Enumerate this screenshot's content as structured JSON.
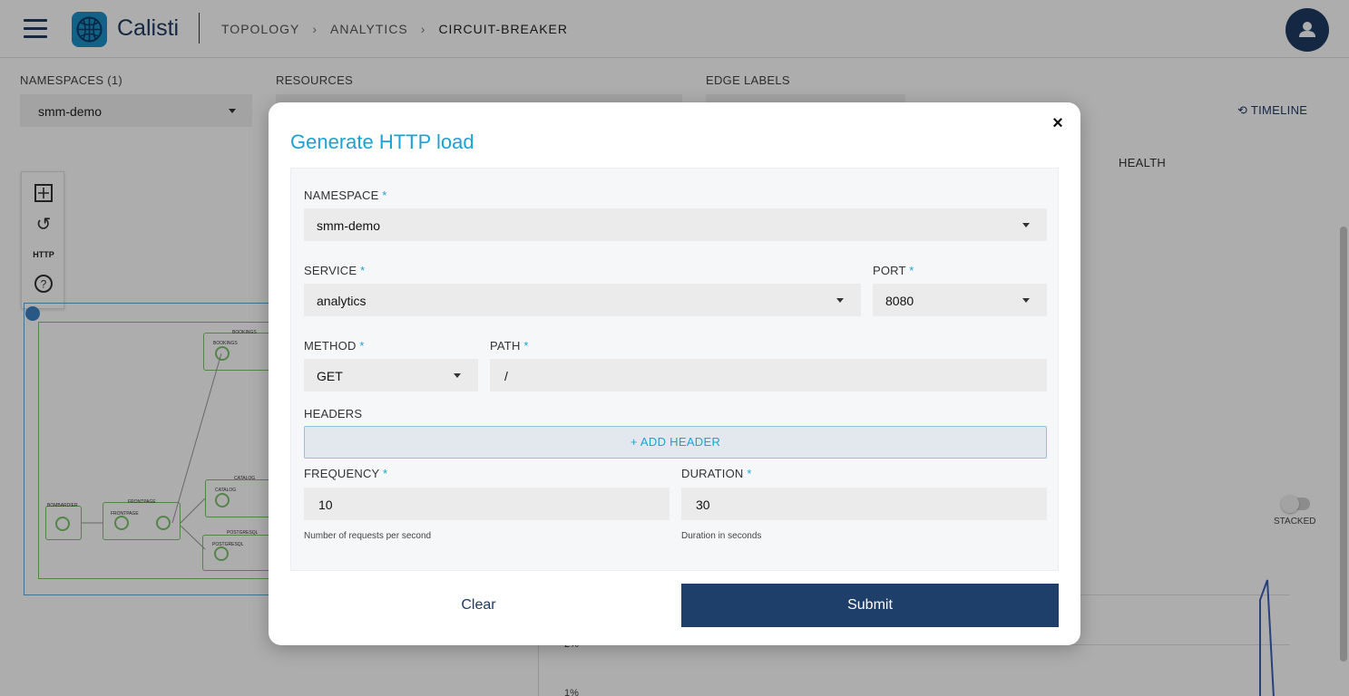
{
  "app": {
    "brand": "Calisti",
    "breadcrumbs": [
      "TOPOLOGY",
      "ANALYTICS",
      "CIRCUIT-BREAKER"
    ]
  },
  "filters": {
    "namespaces_label": "NAMESPACES (1)",
    "namespaces_value": "smm-demo",
    "resources_label": "RESOURCES",
    "edge_labels_label": "EDGE LABELS",
    "timeline_label": "TIMELINE"
  },
  "toolpanel": {
    "http_label": "HTTP"
  },
  "graph": {
    "group_labels": [
      "BOOKINGS",
      "CATALOG",
      "FRONTPAGE",
      "POSTGRESQL",
      "BOMBARDIER"
    ],
    "node_labels": [
      "bookings",
      "catalog",
      "frontpage",
      "postgresql"
    ]
  },
  "background_panel": {
    "health_tab": "HEALTH",
    "stacked_label": "STACKED",
    "ticks": [
      "2%",
      "1%"
    ]
  },
  "modal": {
    "title": "Generate HTTP load",
    "close_glyph": "×",
    "namespace": {
      "label": "NAMESPACE",
      "value": "smm-demo"
    },
    "service": {
      "label": "SERVICE",
      "value": "analytics"
    },
    "port": {
      "label": "PORT",
      "value": "8080"
    },
    "method": {
      "label": "METHOD",
      "value": "GET"
    },
    "path": {
      "label": "PATH",
      "value": "/"
    },
    "headers": {
      "label": "HEADERS",
      "add_label": "+ ADD HEADER"
    },
    "frequency": {
      "label": "FREQUENCY",
      "value": "10",
      "hint": "Number of requests per second"
    },
    "duration": {
      "label": "DURATION",
      "value": "30",
      "hint": "Duration in seconds"
    },
    "required_marker": "*",
    "clear_label": "Clear",
    "submit_label": "Submit"
  },
  "colors": {
    "accent": "#1aa3d4",
    "primary": "#1f3f6b",
    "brand_dark": "#1f3b63"
  },
  "icons": [
    "menu-icon",
    "calisti-logo-icon",
    "user-icon",
    "chevron-right-icon",
    "clock-history-icon",
    "fit-view-icon",
    "reset-icon",
    "help-icon",
    "close-icon",
    "caret-down-icon"
  ]
}
